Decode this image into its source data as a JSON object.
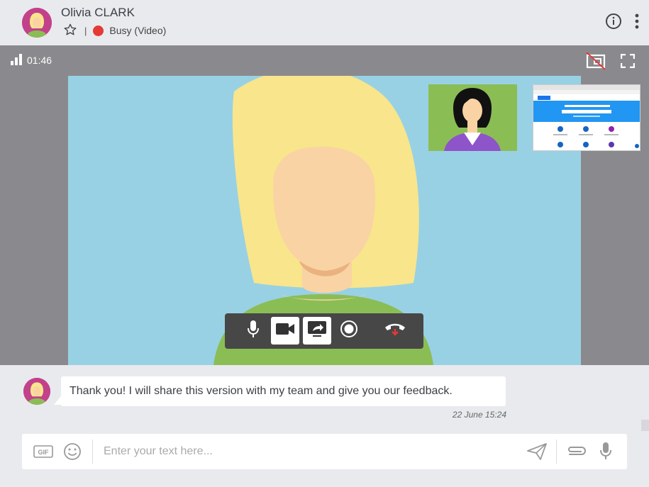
{
  "contact": {
    "name": "Olivia CLARK",
    "status": "Busy (Video)",
    "status_color": "#e53935"
  },
  "call": {
    "duration": "01:46"
  },
  "controls": {
    "mic_icon": "microphone-icon",
    "camera_icon": "video-camera-icon",
    "share_icon": "screen-share-icon",
    "record_icon": "record-icon",
    "hangup_icon": "hang-up-icon"
  },
  "chat": {
    "messages": [
      {
        "text": "Thank you! I will share this version with my team and give you our feedback.",
        "time": "22 June 15:24"
      }
    ],
    "input_placeholder": "Enter your text here..."
  },
  "colors": {
    "video_bg": "#98d1e4",
    "hair": "#f8e58c",
    "skin": "#f9d3a4",
    "shirt": "#8bbd55",
    "avatar_bg": "#c2418a",
    "bar_gray": "#8a8a8e"
  }
}
